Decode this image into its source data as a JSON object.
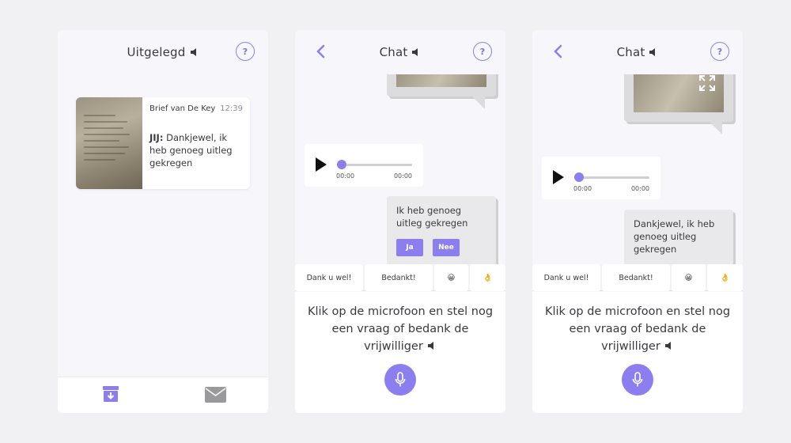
{
  "screens": [
    {
      "title": "Uitgelegd",
      "help_label": "?",
      "card": {
        "from": "Brief van De Key",
        "time": "12:39",
        "sender": "JIJ:",
        "message": " Dankjewel, ik heb genoeg uitleg gekregen"
      },
      "nav": {
        "left_icon": "archive-download-icon",
        "right_icon": "envelope-icon"
      }
    },
    {
      "title": "Chat",
      "help_label": "?",
      "audio": {
        "current": "00:00",
        "duration": "00:00",
        "progress": 0
      },
      "bubble_text": "Ik heb genoeg uitleg gekregen",
      "yes_label": "Ja",
      "no_label": "Nee"
    },
    {
      "title": "Chat",
      "help_label": "?",
      "audio": {
        "current": "00:00",
        "duration": "00:00",
        "progress": 0
      },
      "bubble_text": "Dankjewel, ik heb genoeg uitleg gekregen"
    }
  ],
  "quick_replies": [
    "Dank u wel!",
    "Bedankt!",
    "😀",
    "👌"
  ],
  "prompt": "Klik op de microfoon en stel nog een vraag of bedank de vrijwilliger",
  "colors": {
    "accent": "#8b7ff0",
    "bubble": "#e9e9eb",
    "background": "#f1f1f3"
  }
}
